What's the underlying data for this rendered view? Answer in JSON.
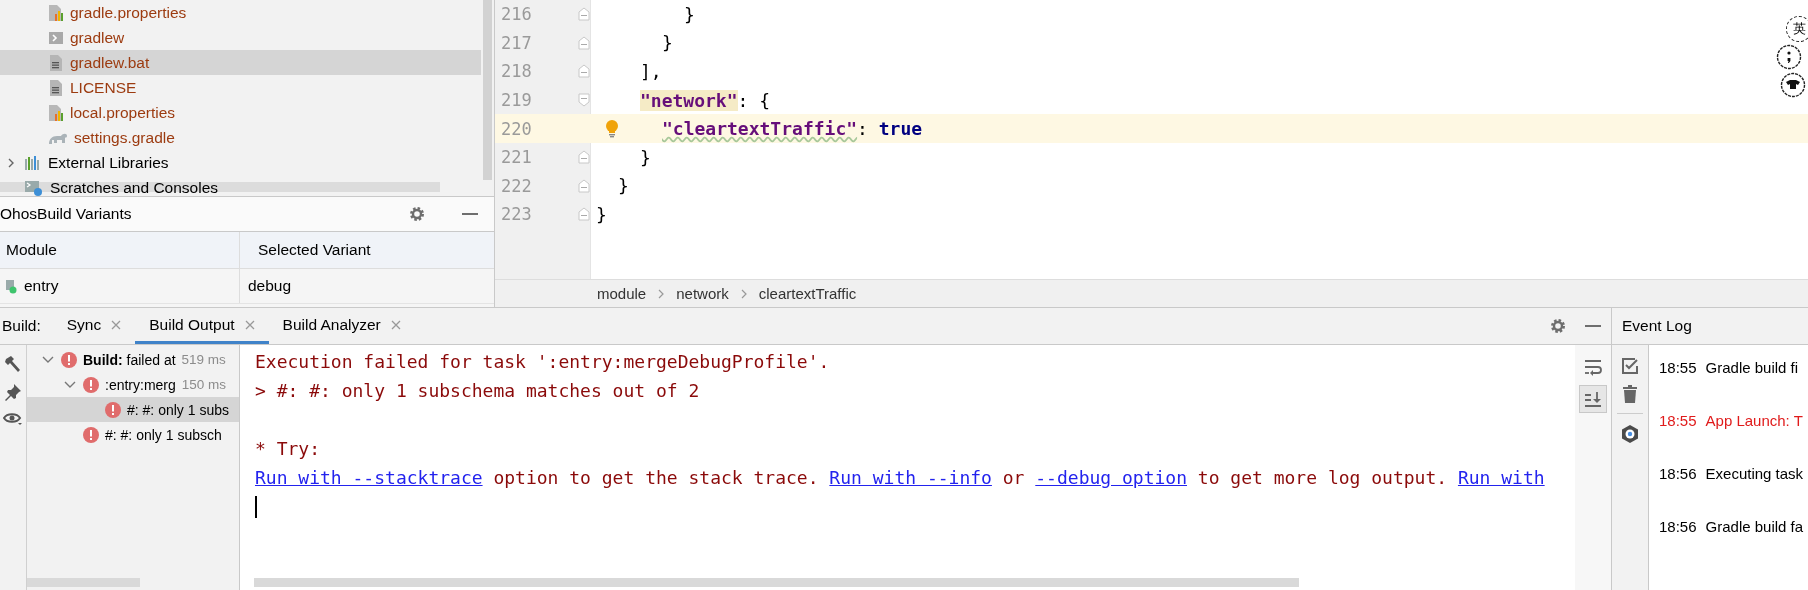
{
  "project_tree": [
    {
      "children": [
        {
          "label": "gradle.properties",
          "kind": "properties",
          "color": "#9c3b10",
          "selected": false
        },
        {
          "label": "gradlew",
          "kind": "script",
          "color": "#9c3b10",
          "selected": false
        },
        {
          "label": "gradlew.bat",
          "kind": "text",
          "color": "#9c3b10",
          "selected": true
        },
        {
          "label": "LICENSE",
          "kind": "text",
          "color": "#9c3b10",
          "selected": false
        },
        {
          "label": "local.properties",
          "kind": "properties",
          "color": "#9c3b10",
          "selected": false
        },
        {
          "label": "settings.gradle",
          "kind": "gradle",
          "color": "#9c3b10",
          "selected": false
        }
      ]
    },
    {
      "label": "External Libraries",
      "kind": "library",
      "color": "#000000",
      "expanded": false,
      "selected": false
    },
    {
      "label": "Scratches and Consoles",
      "kind": "scratches",
      "color": "#000000",
      "selected": false
    }
  ],
  "build_variants": {
    "title": "OhosBuild Variants",
    "columns": [
      "Module",
      "Selected Variant"
    ],
    "rows": [
      {
        "module": "entry",
        "variant": "debug"
      }
    ]
  },
  "editor": {
    "lines": [
      {
        "number": "216",
        "kind": "block-end",
        "current": false,
        "intention": false,
        "tokens": [
          {
            "kind": "punct",
            "text": "}"
          }
        ]
      },
      {
        "number": "217",
        "kind": "block-end",
        "current": false,
        "intention": false,
        "tokens": [
          {
            "kind": "punct",
            "text": "}"
          }
        ]
      },
      {
        "number": "218",
        "kind": "block-end",
        "current": false,
        "intention": false,
        "tokens": [
          {
            "kind": "punct",
            "text": "],"
          }
        ]
      },
      {
        "number": "219",
        "kind": "block-start",
        "current": false,
        "intention": false,
        "tokens": [
          {
            "kind": "key-matched",
            "text": "\"network\""
          },
          {
            "kind": "punct",
            "text": ": {"
          }
        ]
      },
      {
        "number": "220",
        "kind": "plain",
        "current": true,
        "intention": true,
        "tokens": [
          {
            "kind": "key-warning",
            "text": "\"cleartextTraffic\""
          },
          {
            "kind": "punct",
            "text": ": "
          },
          {
            "kind": "keyword",
            "text": "true"
          }
        ]
      },
      {
        "number": "221",
        "kind": "block-end",
        "current": false,
        "intention": false,
        "tokens": [
          {
            "kind": "punct",
            "text": "}"
          }
        ]
      },
      {
        "number": "222",
        "kind": "block-end",
        "current": false,
        "intention": false,
        "tokens": [
          {
            "kind": "punct",
            "text": "}"
          }
        ]
      },
      {
        "number": "223",
        "kind": "block-end",
        "current": false,
        "intention": false,
        "tokens": [
          {
            "kind": "punct",
            "text": "}"
          }
        ]
      }
    ],
    "breadcrumbs": [
      "module",
      "network",
      "cleartextTraffic"
    ]
  },
  "ime_toolbar": {
    "mode_label": "英"
  },
  "build": {
    "label": "Build:",
    "tabs": [
      {
        "label": "Sync",
        "selected": false
      },
      {
        "label": "Build Output",
        "selected": true
      },
      {
        "label": "Build Analyzer",
        "selected": false
      }
    ],
    "tree": [
      {
        "label": "**Build:** failed at",
        "time": "519 ms",
        "expanded": true,
        "selected": false,
        "children": [
          {
            "label": ":entry:merg",
            "time": "150 ms",
            "expanded": true,
            "selected": false,
            "children": [
              {
                "label": "#: #: only 1 subs",
                "selected": true
              }
            ]
          },
          {
            "label": "#: #: only 1 subsch",
            "selected": false
          }
        ]
      }
    ],
    "console": {
      "lines": [
        {
          "kind": "text",
          "segments": [
            {
              "kind": "error",
              "text": "Execution failed for task ':entry:mergeDebugProfile'."
            }
          ]
        },
        {
          "kind": "text",
          "segments": [
            {
              "kind": "error",
              "text": "> #: #: only 1 subschema matches out of 2"
            }
          ]
        },
        {
          "kind": "blank"
        },
        {
          "kind": "text",
          "segments": [
            {
              "kind": "error",
              "text": "* Try:"
            }
          ]
        },
        {
          "kind": "text",
          "segments": [
            {
              "kind": "link",
              "text": "Run with --stacktrace"
            },
            {
              "kind": "error",
              "text": " option to get the stack trace. "
            },
            {
              "kind": "link",
              "text": "Run with --info"
            },
            {
              "kind": "error",
              "text": " or "
            },
            {
              "kind": "link",
              "text": "--debug option"
            },
            {
              "kind": "error",
              "text": " to get more log output. "
            },
            {
              "kind": "link",
              "text": "Run with"
            }
          ]
        }
      ],
      "caret": true
    },
    "console_toolbar": {
      "soft_wrap": false,
      "scroll_to_end": true
    }
  },
  "event_log": {
    "title": "Event Log",
    "entries": [
      {
        "time": "18:55",
        "message": "Gradle build fi",
        "kind": "info"
      },
      {
        "time": "18:55",
        "message": "App Launch: T",
        "kind": "error"
      },
      {
        "time": "18:56",
        "message": "Executing task",
        "kind": "info"
      },
      {
        "time": "18:56",
        "message": "Gradle build fa",
        "kind": "info"
      }
    ]
  }
}
